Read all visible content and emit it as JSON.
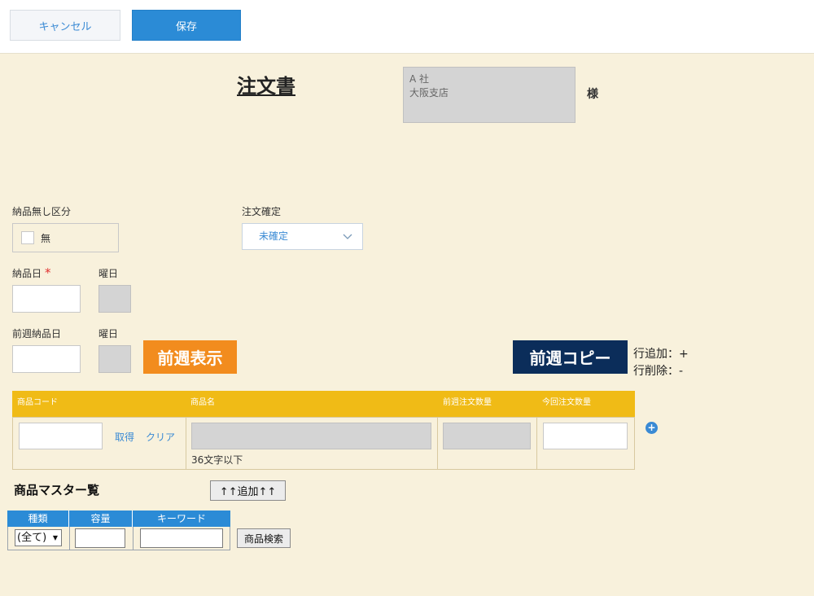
{
  "toolbar": {
    "cancel_label": "キャンセル",
    "save_label": "保存"
  },
  "document": {
    "title": "注文書",
    "customer_line1": "A 社",
    "customer_line2": "大阪支店",
    "honorific": "様"
  },
  "form": {
    "no_delivery_label": "納品無し区分",
    "no_delivery_option": "無",
    "order_confirm_label": "注文確定",
    "order_confirm_value": "未確定",
    "delivery_date_label": "納品日",
    "required_mark": "*",
    "weekday_label": "曜日",
    "prev_delivery_date_label": "前週納品日",
    "weekday_label2": "曜日"
  },
  "actions": {
    "prev_week_show": "前週表示",
    "prev_week_copy": "前週コピー",
    "row_add_hint": "行追加：+",
    "row_delete_hint": "行削除：-"
  },
  "order_table": {
    "headers": [
      "商品コード",
      "商品名",
      "前週注文数量",
      "今回注文数量"
    ],
    "get_link": "取得",
    "clear_link": "クリア",
    "name_hint": "36文字以下",
    "add_row_icon": "+"
  },
  "product_master": {
    "title": "商品マスター覧",
    "add_button": "↑↑追加↑↑",
    "headers": [
      "種類",
      "容量",
      "キーワード"
    ],
    "type_value": "(全て)",
    "search_button": "商品検索"
  },
  "colors": {
    "accent": "#2b8bd6",
    "orange": "#f28c1e",
    "navy": "#0b2d5a",
    "header_yellow": "#f0bb16",
    "bg": "#f8f1dc"
  }
}
